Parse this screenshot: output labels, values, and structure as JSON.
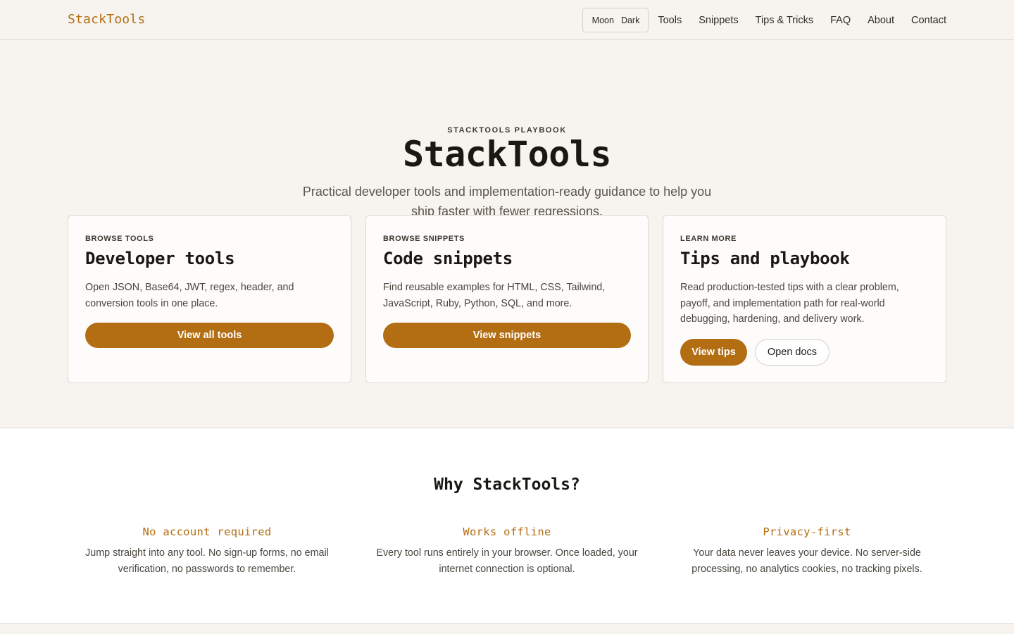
{
  "header": {
    "brand": "StackTools",
    "theme_toggle": {
      "icon_label": "Moon",
      "label": "Dark"
    },
    "nav": [
      "Tools",
      "Snippets",
      "Tips & Tricks",
      "FAQ",
      "About",
      "Contact"
    ]
  },
  "hero": {
    "eyebrow": "STACKTOOLS PLAYBOOK",
    "title": "StackTools",
    "subtitle": "Practical developer tools and implementation-ready guidance to help you ship faster with fewer regressions."
  },
  "cards": [
    {
      "label": "BROWSE TOOLS",
      "title": "Developer tools",
      "description": "Open JSON, Base64, JWT, regex, header, and conversion tools in one place.",
      "button": "View all tools"
    },
    {
      "label": "BROWSE SNIPPETS",
      "title": "Code snippets",
      "description": "Find reusable examples for HTML, CSS, Tailwind, JavaScript, Ruby, Python, SQL, and more.",
      "button": "View snippets"
    },
    {
      "label": "LEARN MORE",
      "title": "Tips and playbook",
      "description": "Read production-tested tips with a clear problem, payoff, and implementation path for real-world debugging, hardening, and delivery work.",
      "primary_button": "View tips",
      "secondary_button": "Open docs"
    }
  ],
  "why": {
    "title": "Why StackTools?",
    "features": [
      {
        "title": "No account required",
        "description": "Jump straight into any tool. No sign-up forms, no email verification, no passwords to remember."
      },
      {
        "title": "Works offline",
        "description": "Every tool runs entirely in your browser. Once loaded, your internet connection is optional."
      },
      {
        "title": "Privacy-first",
        "description": "Your data never leaves your device. No server-side processing, no analytics cookies, no tracking pixels."
      }
    ]
  },
  "colors": {
    "accent": "#b36d12",
    "background": "#f7f4ef",
    "card": "#fdfcfa",
    "section": "#ffffff"
  }
}
